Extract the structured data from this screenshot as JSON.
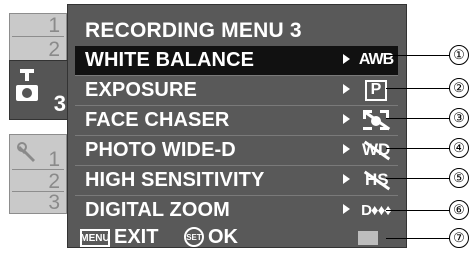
{
  "tabs": {
    "group1": [
      "1",
      "2"
    ],
    "active_number": "3",
    "group2": [
      "1",
      "2",
      "3"
    ]
  },
  "menu": {
    "title": "RECORDING MENU 3",
    "items": [
      {
        "label": "WHITE BALANCE",
        "value": "AWB",
        "icon": "awb-icon",
        "selected": true
      },
      {
        "label": "EXPOSURE",
        "value": "P",
        "icon": "p-exposure-icon",
        "selected": false
      },
      {
        "label": "FACE CHASER",
        "value": "",
        "icon": "face-chaser-off-icon",
        "selected": false
      },
      {
        "label": "PHOTO WIDE-D",
        "value": "WD",
        "icon": "wide-d-off-icon",
        "selected": false
      },
      {
        "label": "HIGH SENSITIVITY",
        "value": "HS",
        "icon": "high-sensitivity-off-icon",
        "selected": false
      },
      {
        "label": "DIGITAL ZOOM",
        "value": "D♦♦♦",
        "icon": "digital-zoom-icon",
        "selected": false
      }
    ],
    "footer": {
      "exit_key": "MENU",
      "exit_label": "EXIT",
      "ok_key": "SET",
      "ok_label": "OK"
    }
  },
  "callouts": [
    "①",
    "②",
    "③",
    "④",
    "⑤",
    "⑥",
    "⑦"
  ]
}
